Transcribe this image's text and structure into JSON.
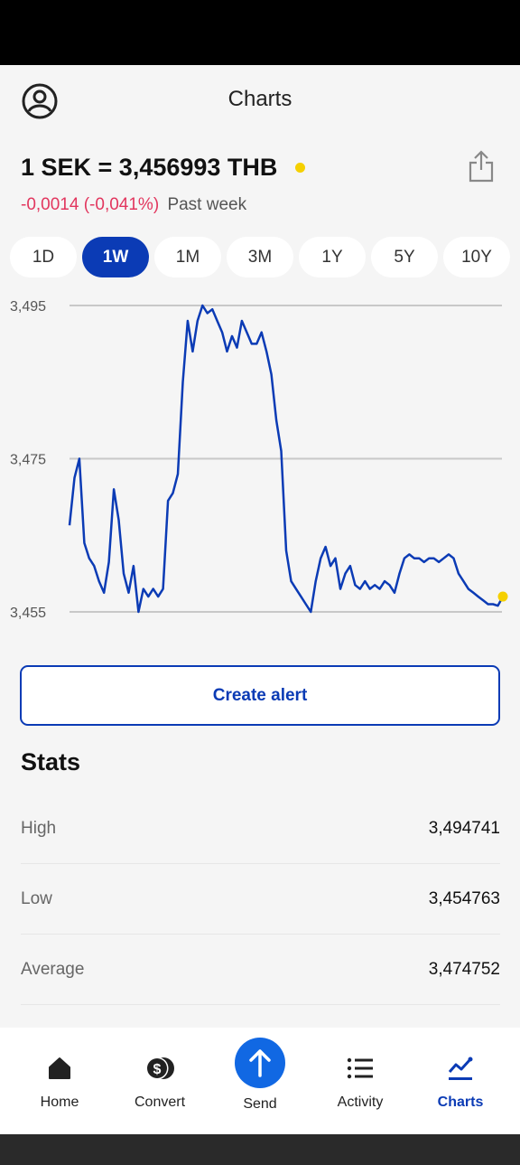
{
  "header": {
    "title": "Charts",
    "profile_icon": "user-circle-icon",
    "share_icon": "share-icon"
  },
  "rate": {
    "text": "1 SEK = 3,456993 THB",
    "change": "-0,0014 (-0,041%)",
    "period": "Past week",
    "change_color": "#e2365e",
    "live_dot_color": "#f5d000"
  },
  "ranges": [
    {
      "label": "1D",
      "active": false
    },
    {
      "label": "1W",
      "active": true
    },
    {
      "label": "1M",
      "active": false
    },
    {
      "label": "3M",
      "active": false
    },
    {
      "label": "1Y",
      "active": false
    },
    {
      "label": "5Y",
      "active": false
    },
    {
      "label": "10Y",
      "active": false
    }
  ],
  "chart_data": {
    "type": "line",
    "title": "",
    "xlabel": "",
    "ylabel": "",
    "ylim": [
      3.455,
      3.495
    ],
    "yticks": [
      {
        "value": 3.495,
        "label": "3,495"
      },
      {
        "value": 3.475,
        "label": "3,475"
      },
      {
        "value": 3.455,
        "label": "3,455"
      }
    ],
    "grid": true,
    "line_color": "#0b3bb5",
    "end_marker_color": "#f5d000",
    "x": [
      0,
      1,
      2,
      3,
      4,
      5,
      6,
      7,
      8,
      9,
      10,
      11,
      12,
      13,
      14,
      15,
      16,
      17,
      18,
      19,
      20,
      21,
      22,
      23,
      24,
      25,
      26,
      27,
      28,
      29,
      30,
      31,
      32,
      33,
      34,
      35,
      36,
      37,
      38,
      39,
      40,
      41,
      42,
      43,
      44,
      45,
      46,
      47,
      48,
      49,
      50,
      51,
      52,
      53,
      54,
      55,
      56,
      57,
      58,
      59,
      60,
      61,
      62,
      63,
      64,
      65,
      66,
      67,
      68,
      69,
      70,
      71,
      72,
      73,
      74,
      75,
      76,
      77,
      78,
      79,
      80,
      81,
      82,
      83,
      84,
      85,
      86,
      87,
      88
    ],
    "values": [
      3.4663,
      3.4725,
      3.475,
      3.464,
      3.462,
      3.461,
      3.459,
      3.4575,
      3.4615,
      3.471,
      3.467,
      3.46,
      3.4575,
      3.461,
      3.455,
      3.458,
      3.457,
      3.458,
      3.457,
      3.458,
      3.4695,
      3.4705,
      3.473,
      3.485,
      3.493,
      3.489,
      3.493,
      3.495,
      3.494,
      3.4945,
      3.493,
      3.4915,
      3.489,
      3.491,
      3.4895,
      3.493,
      3.4915,
      3.49,
      3.49,
      3.4915,
      3.489,
      3.486,
      3.48,
      3.476,
      3.463,
      3.459,
      3.458,
      3.457,
      3.456,
      3.455,
      3.459,
      3.462,
      3.4635,
      3.461,
      3.462,
      3.458,
      3.46,
      3.461,
      3.4585,
      3.458,
      3.459,
      3.458,
      3.4585,
      3.458,
      3.459,
      3.4585,
      3.4575,
      3.46,
      3.462,
      3.4625,
      3.462,
      3.462,
      3.4615,
      3.462,
      3.462,
      3.4615,
      3.462,
      3.4625,
      3.462,
      3.46,
      3.459,
      3.458,
      3.4575,
      3.457,
      3.4565,
      3.456,
      3.456,
      3.4558,
      3.457
    ]
  },
  "actions": {
    "create_alert_label": "Create alert"
  },
  "stats": {
    "title": "Stats",
    "rows": [
      {
        "label": "High",
        "value": "3,494741"
      },
      {
        "label": "Low",
        "value": "3,454763"
      },
      {
        "label": "Average",
        "value": "3,474752"
      }
    ]
  },
  "nav": {
    "items": [
      {
        "label": "Home",
        "icon": "home-icon",
        "active": false
      },
      {
        "label": "Convert",
        "icon": "convert-icon",
        "active": false
      },
      {
        "label": "Send",
        "icon": "send-arrow-icon",
        "active": false
      },
      {
        "label": "Activity",
        "icon": "list-icon",
        "active": false
      },
      {
        "label": "Charts",
        "icon": "chart-line-icon",
        "active": true
      }
    ],
    "accent_color": "#0b3bb5",
    "send_color": "#1168e3"
  }
}
